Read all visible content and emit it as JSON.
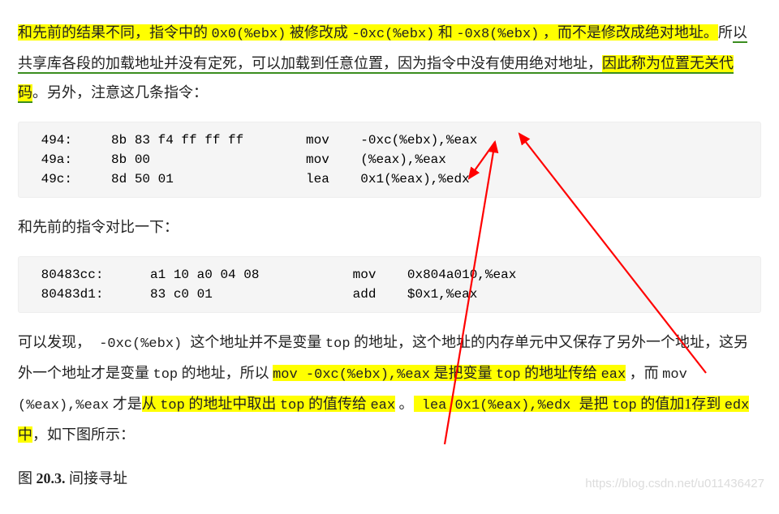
{
  "para1": {
    "t1": "和先前的结果不同，指令中的 ",
    "code1": "0x0(%ebx)",
    "t2": " 被修改成 ",
    "code2": "-0xc(%ebx)",
    "t3": " 和 ",
    "code3": "-0x8(%ebx)",
    "t4": " ，而不是修改成绝对地址。",
    "t5": "所",
    "t6": "以共享库各段的加载地址并没有定死，可以加载到任意位置，因为指令中没有使用绝对地址，",
    "t7": "因此称为位置无关代码",
    "t8": "。另外，注意这几条指令："
  },
  "code_block1": {
    "rows": [
      {
        "addr": "494:",
        "bytes": "8b 83 f4 ff ff ff",
        "mnem": "mov",
        "ops": "-0xc(%ebx),%eax"
      },
      {
        "addr": "49a:",
        "bytes": "8b 00",
        "mnem": "mov",
        "ops": "(%eax),%eax"
      },
      {
        "addr": "49c:",
        "bytes": "8d 50 01",
        "mnem": "lea",
        "ops": "0x1(%eax),%edx"
      }
    ]
  },
  "para2": {
    "t": "和先前的指令对比一下："
  },
  "code_block2": {
    "rows": [
      {
        "addr": "80483cc:",
        "bytes": "a1 10 a0 04 08",
        "mnem": "mov",
        "ops": "0x804a010,%eax"
      },
      {
        "addr": "80483d1:",
        "bytes": "83 c0 01",
        "mnem": "add",
        "ops": "$0x1,%eax"
      }
    ]
  },
  "para3": {
    "t1": "可以发现，",
    "code1": " -0xc(%ebx) ",
    "t2": "这个地址并不是变量 ",
    "code2": "top",
    "t3": " 的地址，这个地址的内存单元中又保存了另外一个地址，这另外一个地址才是变量 ",
    "code4": "top",
    "t4": " 的地址，所以 ",
    "hl1": "mov -0xc(%ebx),%eax",
    "hl1a": " 是把变量 ",
    "hl1b": "top",
    "hl1c": " 的地址传给 ",
    "hl1d": "eax",
    "t5": " ，而 ",
    "code5": "mov (%eax),%eax",
    "t6": " 才是",
    "hl2a": "从 ",
    "hl2b": "top",
    "hl2c": " 的地址中取出 ",
    "hl2d": "top",
    "hl2e": " 的值传给 ",
    "hl2f": "eax",
    "t7": " 。",
    "code6": " lea 0x1(%eax),%edx ",
    "t8": "是把 ",
    "code7": "top",
    "t9": " 的值加1存到 ",
    "code8": "edx",
    "t10": " 中",
    "t11": "，如下图所示："
  },
  "fig": {
    "prefix": "图 ",
    "num": "20.3.",
    "title": " 间接寻址"
  },
  "watermark": "https://blog.csdn.net/u011436427",
  "colors": {
    "highlight": "#ffff00",
    "underline": "#3a8d1f",
    "arrow": "#ff0000"
  }
}
